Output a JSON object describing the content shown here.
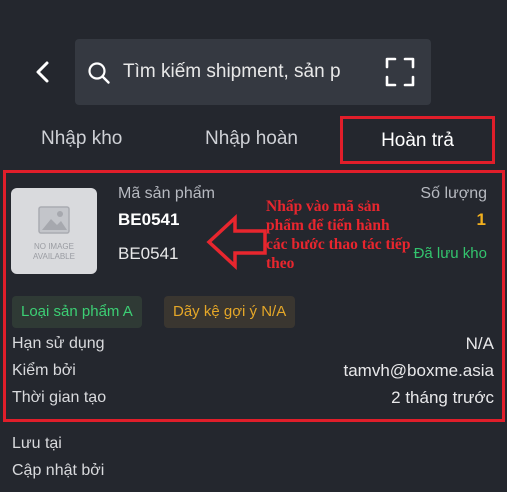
{
  "header": {
    "search_placeholder": "Tìm kiếm shipment, sản p"
  },
  "tabs": [
    {
      "label": "Nhập kho"
    },
    {
      "label": "Nhập hoàn"
    },
    {
      "label": "Hoàn trả"
    }
  ],
  "product": {
    "code_label": "Mã sản phẩm",
    "code": "BE0541",
    "sku": "BE0541",
    "qty_label": "Số lượng",
    "qty": "1",
    "status": "Đã lưu kho",
    "no_image_line1": "NO IMAGE",
    "no_image_line2": "AVAILABLE",
    "tag_type": "Loại sản phẩm A",
    "tag_shelf": "Dãy kệ gợi ý N/A",
    "expiry_label": "Hạn sử dụng",
    "expiry_value": "N/A",
    "checked_by_label": "Kiểm bởi",
    "checked_by_value": "tamvh@boxme.asia",
    "created_label": "Thời gian tạo",
    "created_value": "2 tháng trước"
  },
  "annotation": {
    "text": "Nhấp vào mã sản phẩm để tiến hành các bước thao tác tiếp theo"
  },
  "footer": {
    "stored_at_label": "Lưu tại",
    "updated_by_label": "Cập nhật bởi"
  },
  "colors": {
    "background": "#24272e",
    "highlight": "#e01e2a",
    "quantity": "#f2b01e",
    "status": "#33c46e"
  }
}
